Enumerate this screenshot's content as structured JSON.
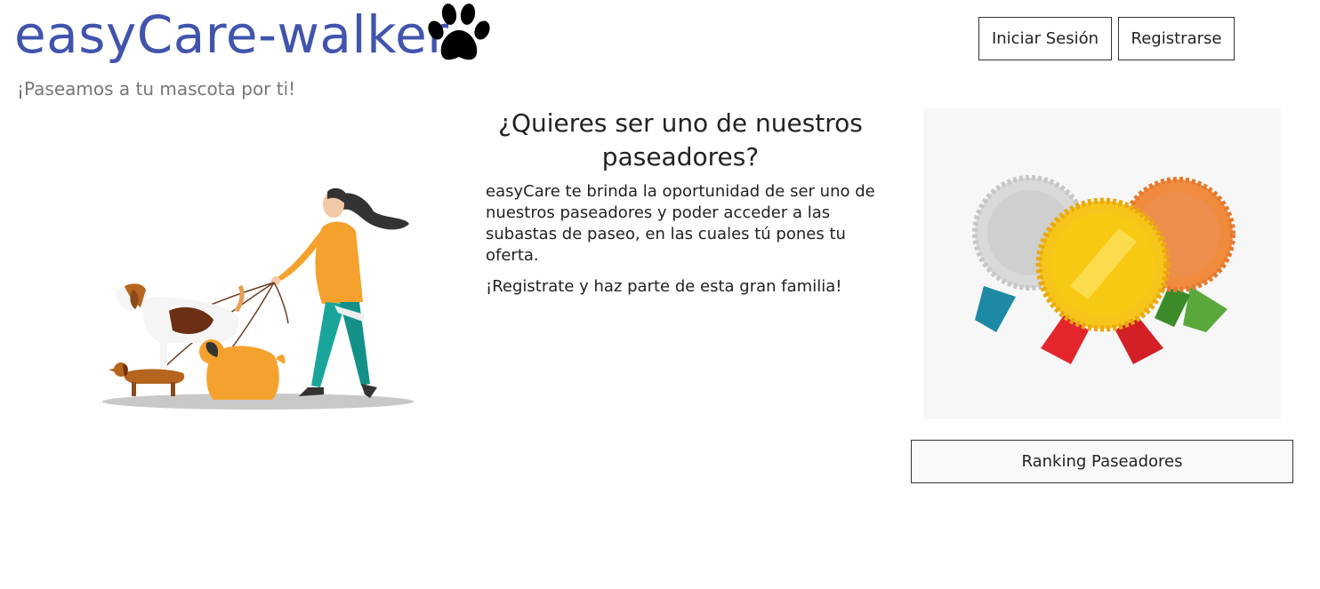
{
  "brand": {
    "name": "easyCare-walker",
    "tagline": "¡Paseamos a tu mascota por ti!",
    "color": "#4154ad",
    "icon": "paw-icon"
  },
  "header": {
    "login_label": "Iniciar Sesión",
    "register_label": "Registrarse"
  },
  "main": {
    "headline": "¿Quieres ser uno de nuestros paseadores?",
    "paragraph1": "easyCare te brinda la oportunidad de ser uno de nuestros paseadores y poder acceder a las subastas de paseo, en las cuales tú pones tu oferta.",
    "paragraph2": "¡Registrate y haz parte de esta gran familia!"
  },
  "side": {
    "ranking_label": "Ranking Paseadores"
  }
}
